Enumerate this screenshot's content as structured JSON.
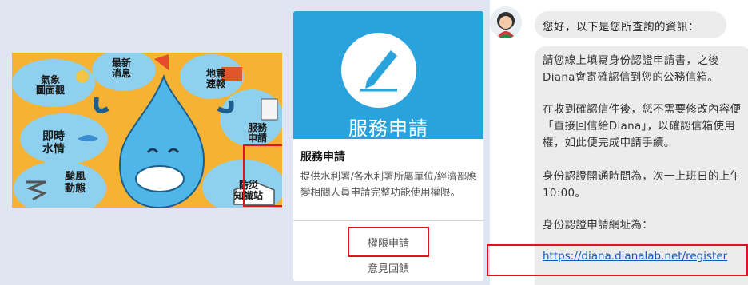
{
  "illustration": {
    "bubbles": [
      {
        "label": "氣象\n圖面觀"
      },
      {
        "label": "最新\n消息"
      },
      {
        "label": "地震\n速報"
      },
      {
        "label": "即時\n水情"
      },
      {
        "label": "服務\n申請"
      },
      {
        "label": "颱風\n動態"
      },
      {
        "label": "防災\n知識站"
      }
    ]
  },
  "card": {
    "hero_title": "服務申請",
    "heading": "服務申請",
    "description": "提供水利署/各水利署所屬單位/經濟部應變相關人員申請完整功能使用權限。",
    "actions": {
      "permission": "權限申請",
      "feedback": "意見回饋"
    }
  },
  "chat": {
    "greeting": "您好，以下是您所查詢的資訊：",
    "paragraphs": [
      "請您線上填寫身份認證申請書，之後Diana會寄確認信到您的公務信箱。",
      "在收到確認信件後，您不需要修改內容便「直接回信給Diana」，以確認信箱使用權，如此便完成申請手續。",
      "身份認證開通時間為，次一上班日的上午10:00。",
      "身份認證申請網址為："
    ],
    "link": "https://diana.dianalab.net/register"
  },
  "colors": {
    "accent_blue": "#2aa3dc",
    "highlight_red": "#e0141e",
    "link_blue": "#1a58b8"
  }
}
